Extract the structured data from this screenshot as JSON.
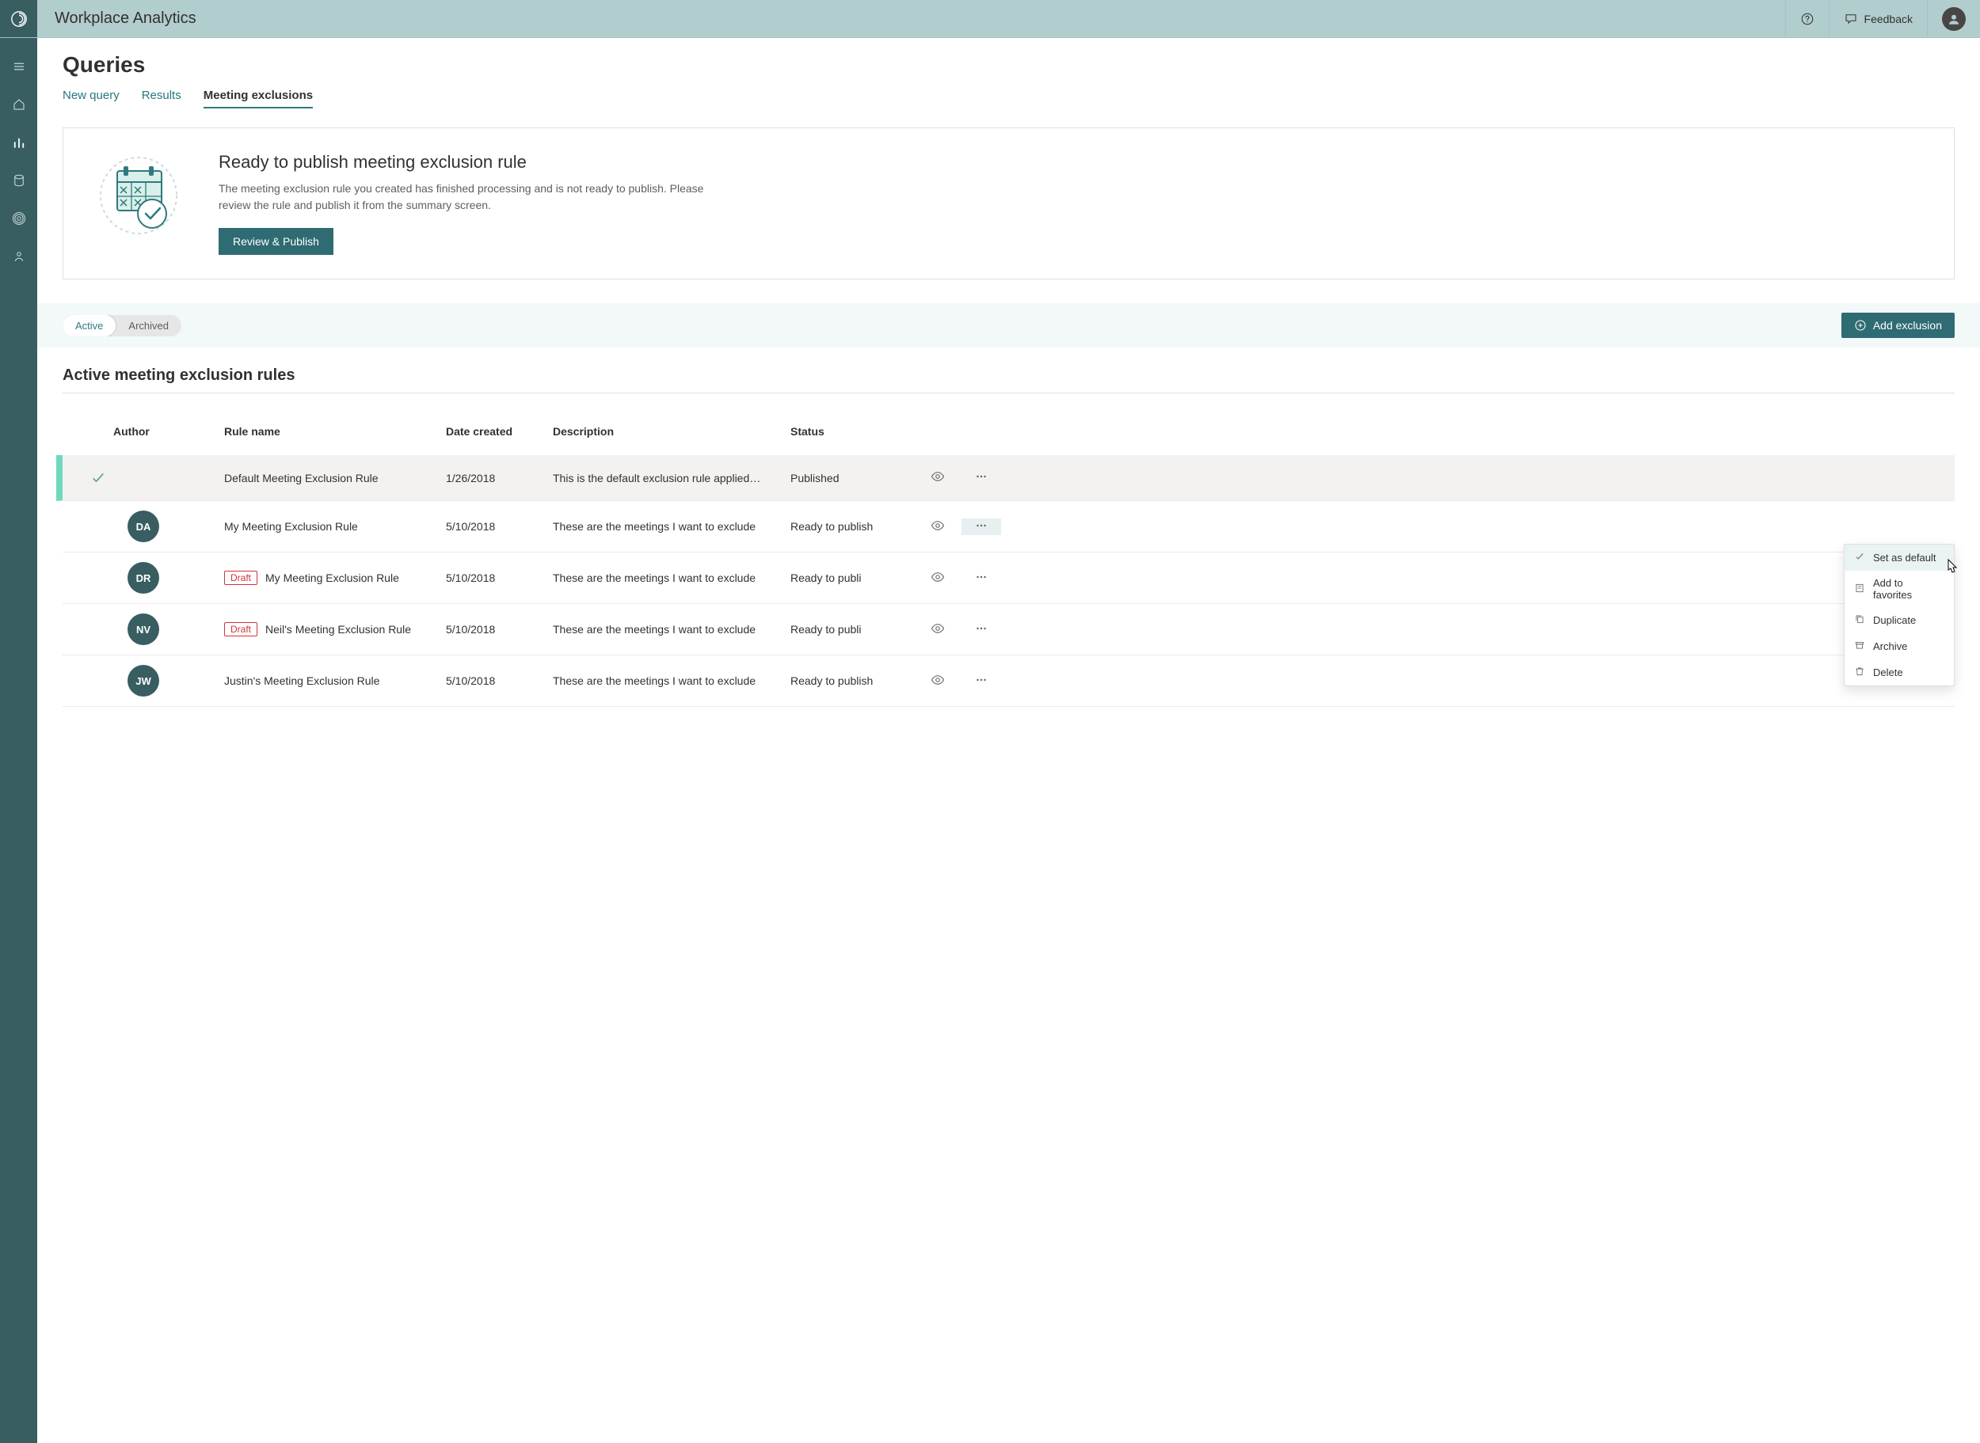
{
  "header": {
    "app_title": "Workplace Analytics",
    "help_label": "Help",
    "feedback_label": "Feedback"
  },
  "page": {
    "title": "Queries"
  },
  "tabs": [
    {
      "label": "New query",
      "active": false
    },
    {
      "label": "Results",
      "active": false
    },
    {
      "label": "Meeting exclusions",
      "active": true
    }
  ],
  "notice": {
    "title": "Ready to publish meeting exclusion rule",
    "body": "The meeting exclusion rule you created has finished processing and is not ready to publish. Please review the rule and publish it from the summary screen.",
    "button": "Review & Publish"
  },
  "toolbar": {
    "pills": [
      {
        "label": "Active",
        "active": true
      },
      {
        "label": "Archived",
        "active": false
      }
    ],
    "add_label": "Add exclusion"
  },
  "section": {
    "title": "Active meeting exclusion rules"
  },
  "columns": {
    "c0": "",
    "c1": "Author",
    "c2": "Rule name",
    "c3": "Date created",
    "c4": "Description",
    "c5": "Status",
    "c6": "",
    "c7": ""
  },
  "rows": [
    {
      "default_marker": true,
      "author": "",
      "draft": false,
      "name": "Default Meeting Exclusion Rule",
      "date": "1/26/2018",
      "desc": "This is the default exclusion rule applied…",
      "status": "Published",
      "menu_open": false
    },
    {
      "default_marker": false,
      "author": "DA",
      "draft": false,
      "name": "My Meeting Exclusion Rule",
      "date": "5/10/2018",
      "desc": "These are the meetings I want to exclude",
      "status": "Ready to publish",
      "menu_open": true
    },
    {
      "default_marker": false,
      "author": "DR",
      "draft": true,
      "draft_label": "Draft",
      "name": "My Meeting Exclusion Rule",
      "date": "5/10/2018",
      "desc": "These are the meetings I want to exclude",
      "status": "Ready to publi",
      "menu_open": false
    },
    {
      "default_marker": false,
      "author": "NV",
      "draft": true,
      "draft_label": "Draft",
      "name": "Neil's Meeting Exclusion Rule",
      "date": "5/10/2018",
      "desc": "These are the meetings I want to exclude",
      "status": "Ready to publi",
      "menu_open": false
    },
    {
      "default_marker": false,
      "author": "JW",
      "draft": false,
      "name": "Justin's Meeting Exclusion Rule",
      "date": "5/10/2018",
      "desc": "These are the meetings I want to exclude",
      "status": "Ready to publish",
      "menu_open": false
    }
  ],
  "context_menu": [
    {
      "label": "Set as default",
      "icon": "check"
    },
    {
      "label": "Add to favorites",
      "icon": "favorite"
    },
    {
      "label": "Duplicate",
      "icon": "copy"
    },
    {
      "label": "Archive",
      "icon": "archive"
    },
    {
      "label": "Delete",
      "icon": "delete"
    }
  ]
}
